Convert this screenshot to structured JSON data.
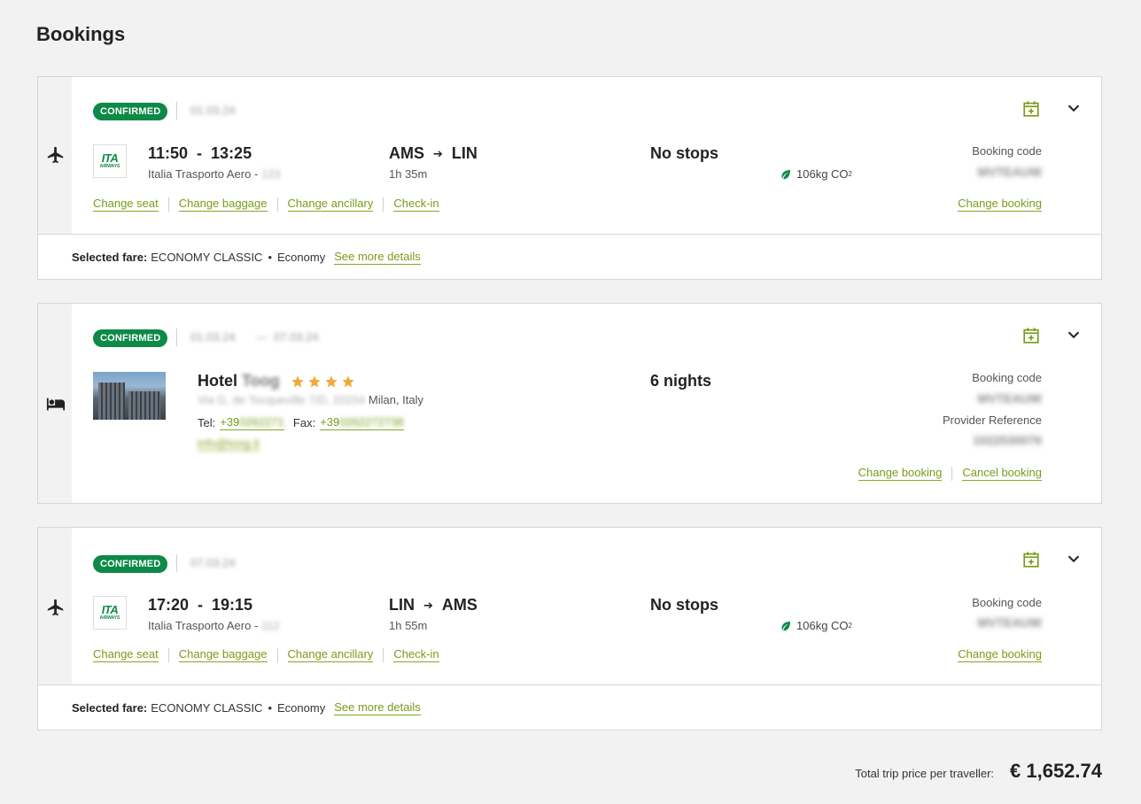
{
  "page": {
    "title": "Bookings"
  },
  "colors": {
    "accent": "#7a9a1a",
    "confirmed": "#0d8a47",
    "star": "#f2a93b"
  },
  "bookings": [
    {
      "type": "flight",
      "status": "CONFIRMED",
      "date": "01.03.24",
      "times": "11:50  -  13:25",
      "carrier": "Italia Trasporto Aero - ",
      "flight_no": "123",
      "origin": "AMS",
      "destination": "LIN",
      "duration": "1h 35m",
      "stops": "No stops",
      "co2": "106kg CO",
      "co2_sub": "2",
      "booking_code_label": "Booking code",
      "booking_code": "MVTEAUW",
      "links": [
        "Change seat",
        "Change baggage",
        "Change ancillary",
        "Check-in"
      ],
      "change_booking": "Change booking",
      "fare_label": "Selected fare:",
      "fare": "ECONOMY CLASSIC",
      "cabin": "Economy",
      "details_link": "See more details"
    },
    {
      "type": "hotel",
      "status": "CONFIRMED",
      "date_start": "01.03.24",
      "date_end": "07.03.24",
      "name": "Hotel",
      "name_blur": "Toog",
      "stars": 4,
      "address_blur": "Via G. de Tocqueville 7/D, 20154",
      "address_city": "Milan, Italy",
      "tel_label": "Tel:",
      "tel_prefix": "+39",
      "tel_rest": "0262271",
      "fax_label": "Fax:",
      "fax_prefix": "+39",
      "fax_rest": "0262272738",
      "email_blur": "info@toog.it",
      "nights": "6 nights",
      "booking_code_label": "Booking code",
      "booking_code": "MVTEAUW",
      "provider_label": "Provider Reference",
      "provider_ref": "1022530076",
      "change_booking": "Change booking",
      "cancel_booking": "Cancel booking"
    },
    {
      "type": "flight",
      "status": "CONFIRMED",
      "date": "07.03.24",
      "times": "17:20  -  19:15",
      "carrier": "Italia Trasporto Aero - ",
      "flight_no": "112",
      "origin": "LIN",
      "destination": "AMS",
      "duration": "1h 55m",
      "stops": "No stops",
      "co2": "106kg CO",
      "co2_sub": "2",
      "booking_code_label": "Booking code",
      "booking_code": "MVTEAUW",
      "links": [
        "Change seat",
        "Change baggage",
        "Change ancillary",
        "Check-in"
      ],
      "change_booking": "Change booking",
      "fare_label": "Selected fare:",
      "fare": "ECONOMY CLASSIC",
      "cabin": "Economy",
      "details_link": "See more details"
    }
  ],
  "logo": {
    "text": "ITA",
    "sub": "AIRWAYS"
  },
  "total": {
    "label": "Total trip price per traveller:",
    "value": "€ 1,652.74"
  }
}
